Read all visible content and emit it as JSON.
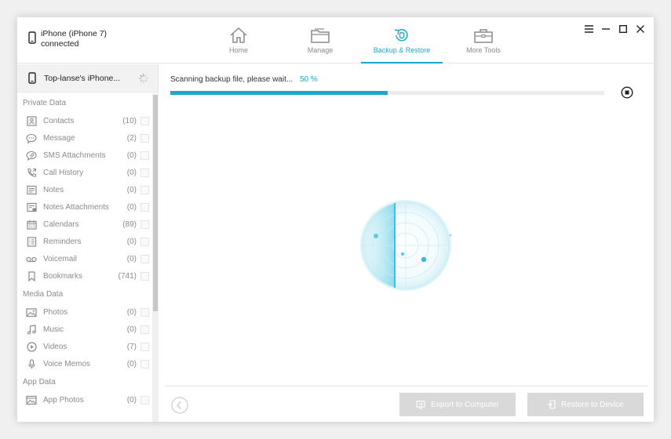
{
  "device": {
    "name": "iPhone (iPhone 7)",
    "status": "connected"
  },
  "nav": [
    {
      "label": "Home",
      "icon": "home-icon"
    },
    {
      "label": "Manage",
      "icon": "folder-icon"
    },
    {
      "label": "Backup & Restore",
      "icon": "backup-restore-icon",
      "active": true
    },
    {
      "label": "More Tools",
      "icon": "toolbox-icon"
    }
  ],
  "sidebar": {
    "device_name": "Top-lanse's iPhone...",
    "sections": [
      {
        "title": "Private Data",
        "items": [
          {
            "label": "Contacts",
            "count": "(10)",
            "icon": "contact-card-icon"
          },
          {
            "label": "Message",
            "count": "(2)",
            "icon": "message-bubble-icon"
          },
          {
            "label": "SMS Attachments",
            "count": "(0)",
            "icon": "sms-attachment-icon"
          },
          {
            "label": "Call History",
            "count": "(0)",
            "icon": "phone-call-icon"
          },
          {
            "label": "Notes",
            "count": "(0)",
            "icon": "notes-icon"
          },
          {
            "label": "Notes Attachments",
            "count": "(0)",
            "icon": "notes-attachment-icon"
          },
          {
            "label": "Calendars",
            "count": "(89)",
            "icon": "calendar-icon"
          },
          {
            "label": "Reminders",
            "count": "(0)",
            "icon": "reminder-list-icon"
          },
          {
            "label": "Voicemail",
            "count": "(0)",
            "icon": "voicemail-icon"
          },
          {
            "label": "Bookmarks",
            "count": "(741)",
            "icon": "bookmark-icon"
          }
        ]
      },
      {
        "title": "Media Data",
        "items": [
          {
            "label": "Photos",
            "count": "(0)",
            "icon": "photo-icon"
          },
          {
            "label": "Music",
            "count": "(0)",
            "icon": "music-note-icon"
          },
          {
            "label": "Videos",
            "count": "(7)",
            "icon": "play-circle-icon"
          },
          {
            "label": "Voice Memos",
            "count": "(0)",
            "icon": "microphone-icon"
          }
        ]
      },
      {
        "title": "App Data",
        "items": [
          {
            "label": "App Photos",
            "count": "(0)",
            "icon": "app-photo-icon"
          }
        ]
      }
    ]
  },
  "scan": {
    "status_text": "Scanning backup file, please wait...",
    "percent_text": "50 %",
    "progress": 0.5
  },
  "footer": {
    "export_label": "Export to Computer",
    "restore_label": "Restore to Device"
  },
  "colors": {
    "accent": "#1aa8cc",
    "muted_text": "#8a8a8a",
    "disabled_button": "#d9d9d9"
  }
}
